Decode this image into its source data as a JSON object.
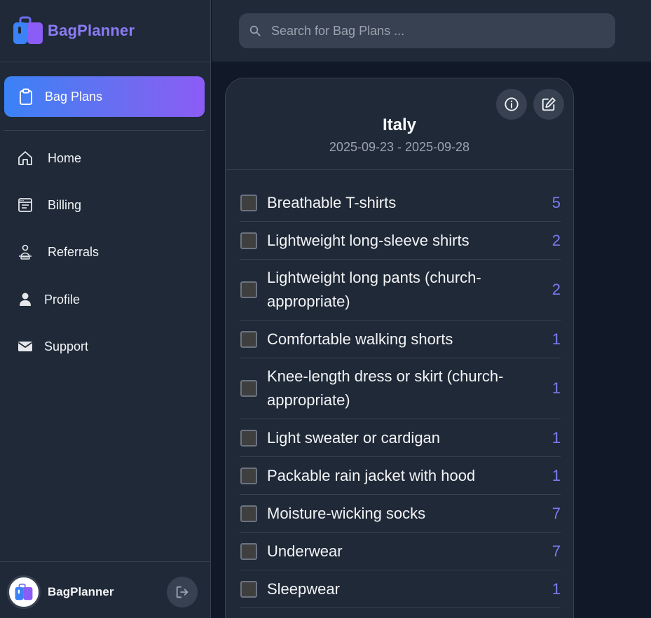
{
  "brand": {
    "name": "BagPlanner"
  },
  "search": {
    "placeholder": "Search for Bag Plans ..."
  },
  "nav": {
    "active": {
      "label": "Bag Plans",
      "icon": "clipboard-icon"
    },
    "items": [
      {
        "label": "Home",
        "icon": "home-icon"
      },
      {
        "label": "Billing",
        "icon": "billing-icon"
      },
      {
        "label": "Referrals",
        "icon": "referrals-icon"
      },
      {
        "label": "Profile",
        "icon": "user-icon"
      },
      {
        "label": "Support",
        "icon": "mail-icon"
      }
    ]
  },
  "user": {
    "name": "BagPlanner"
  },
  "plan": {
    "title": "Italy",
    "dates": "2025-09-23 - 2025-09-28",
    "items": [
      {
        "name": "Breathable T-shirts",
        "qty": "5",
        "checked": false
      },
      {
        "name": "Lightweight long-sleeve shirts",
        "qty": "2",
        "checked": false
      },
      {
        "name": "Lightweight long pants (church-appropriate)",
        "qty": "2",
        "checked": false
      },
      {
        "name": "Comfortable walking shorts",
        "qty": "1",
        "checked": false
      },
      {
        "name": "Knee-length dress or skirt (church-appropriate)",
        "qty": "1",
        "checked": false
      },
      {
        "name": "Light sweater or cardigan",
        "qty": "1",
        "checked": false
      },
      {
        "name": "Packable rain jacket with hood",
        "qty": "1",
        "checked": false
      },
      {
        "name": "Moisture-wicking socks",
        "qty": "7",
        "checked": false
      },
      {
        "name": "Underwear",
        "qty": "7",
        "checked": false
      },
      {
        "name": "Sleepwear",
        "qty": "1",
        "checked": false
      }
    ]
  },
  "colors": {
    "accent_start": "#3b82f6",
    "accent_end": "#8b5cf6",
    "brand_text": "#8b7cf6",
    "quantity": "#7b7bf0"
  }
}
